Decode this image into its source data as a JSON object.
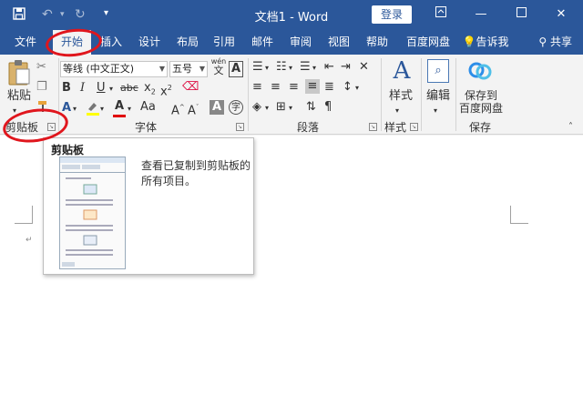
{
  "titlebar": {
    "title": "文档1 - Word",
    "login": "登录",
    "save_icon": "save-icon",
    "undo_icon": "undo-icon",
    "redo_icon": "redo-icon"
  },
  "tabs": [
    "文件",
    "开始",
    "插入",
    "设计",
    "布局",
    "引用",
    "邮件",
    "审阅",
    "视图",
    "帮助",
    "百度网盘"
  ],
  "tell_me": "告诉我",
  "share": "共享",
  "ribbon": {
    "clipboard": {
      "paste": "粘贴",
      "label": "剪贴板"
    },
    "font": {
      "name": "等线 (中文正文)",
      "size": "五号",
      "wen": "wén",
      "wen_char": "文",
      "label": "字体"
    },
    "paragraph": {
      "label": "段落"
    },
    "styles": {
      "button": "样式",
      "label": "样式"
    },
    "editing": {
      "button": "编辑"
    },
    "save": {
      "button_line1": "保存到",
      "button_line2": "百度网盘",
      "label": "保存"
    }
  },
  "tooltip": {
    "title": "剪贴板",
    "description": "查看已复制到剪贴板的所有项目。"
  },
  "colors": {
    "brand": "#2b579a",
    "annotation": "#e0161d",
    "font_color_bar": "#e00000",
    "highlight_bar": "#ffff00"
  }
}
